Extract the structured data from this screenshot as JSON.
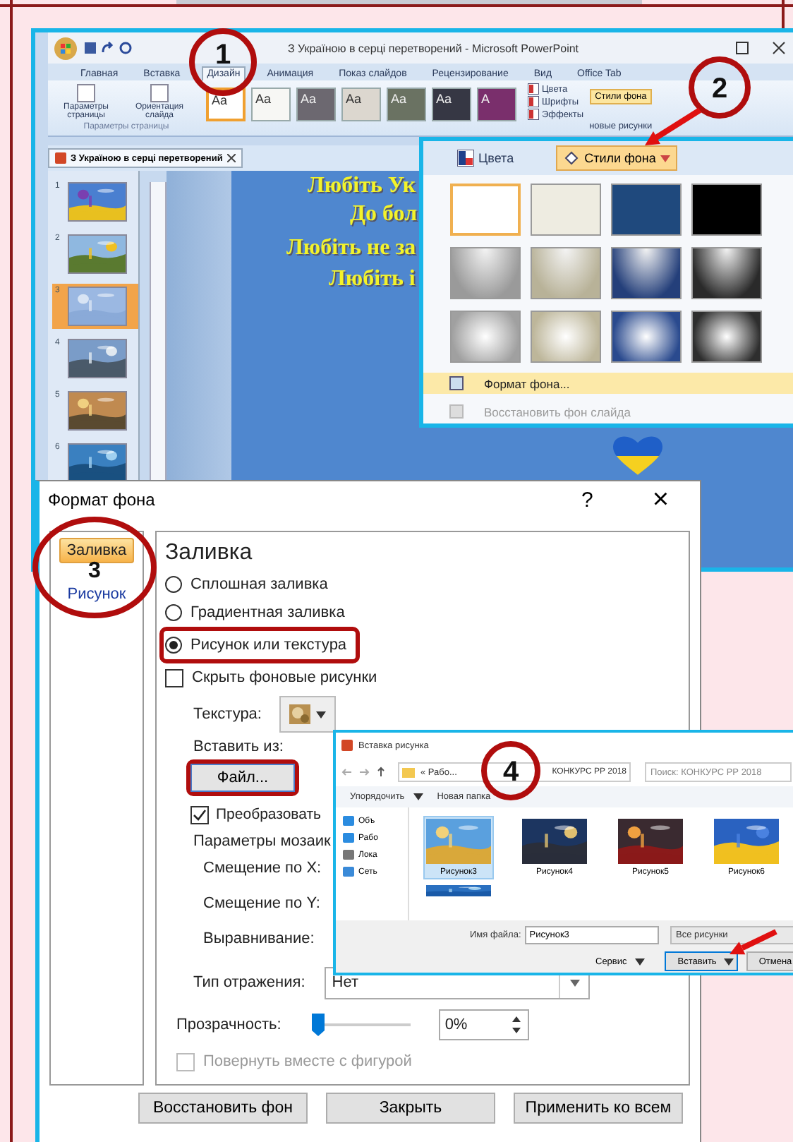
{
  "powerpoint": {
    "title": "З Україною в серці перетворений - Microsoft PowerPoint",
    "tabs": [
      {
        "label": "Главная",
        "selected": false
      },
      {
        "label": "Вставка",
        "selected": false
      },
      {
        "label": "Дизайн",
        "selected": true
      },
      {
        "label": "Анимация",
        "selected": false
      },
      {
        "label": "Показ слайдов",
        "selected": false
      },
      {
        "label": "Рецензирование",
        "selected": false
      },
      {
        "label": "Вид",
        "selected": false
      },
      {
        "label": "Office Tab",
        "selected": false
      }
    ],
    "page_setup_buttons": [
      "Параметры страницы",
      "Ориентация слайда"
    ],
    "page_setup_group": "Параметры страницы",
    "themes": [
      {
        "label": "Aa",
        "color": "#ffffff",
        "selected": true
      },
      {
        "label": "Aa",
        "color": "#f7f7f4",
        "selected": false
      },
      {
        "label": "Aa",
        "color": "#6c6870",
        "selected": false
      },
      {
        "label": "Aa",
        "color": "#dcd7cf",
        "selected": false
      },
      {
        "label": "Aa",
        "color": "#6a7262",
        "selected": false
      },
      {
        "label": "Aa",
        "color": "#363744",
        "selected": false
      },
      {
        "label": "A",
        "color": "#7a2f6c",
        "selected": false
      }
    ],
    "theme_options": [
      "Цвета",
      "Шрифты",
      "Эффекты"
    ],
    "background_styles": "Стили фона",
    "hide_graphics": "новые рисунки",
    "document_tab": "З Україною в серці перетворений",
    "slides": [
      {
        "number": "1",
        "selected": false
      },
      {
        "number": "2",
        "selected": false
      },
      {
        "number": "3",
        "selected": true
      },
      {
        "number": "4",
        "selected": false
      },
      {
        "number": "5",
        "selected": false
      },
      {
        "number": "6",
        "selected": false
      }
    ],
    "slide_text": [
      "Любіть Ук",
      "До бол",
      "Любіть не за",
      "Любіть і"
    ]
  },
  "styles_menu": {
    "colors": "Цвета",
    "button": "Стили фона",
    "swatches": [
      {
        "kind": "solid",
        "color": "#ffffff",
        "selected": true
      },
      {
        "kind": "solid",
        "color": "#eeece1",
        "selected": false
      },
      {
        "kind": "solid",
        "color": "#1f497d",
        "selected": false
      },
      {
        "kind": "solid",
        "color": "#000000",
        "selected": false
      },
      {
        "kind": "gradient",
        "color": "#9a9a9a",
        "selected": false
      },
      {
        "kind": "gradient",
        "color": "#b8b298",
        "selected": false
      },
      {
        "kind": "gradient",
        "color": "#243f7a",
        "selected": false
      },
      {
        "kind": "gradient",
        "color": "#2a2a2a",
        "selected": false
      },
      {
        "kind": "radial",
        "color": "#a0a0a0",
        "selected": false
      },
      {
        "kind": "radial",
        "color": "#bdb69a",
        "selected": false
      },
      {
        "kind": "radial",
        "color": "#2a4a8e",
        "selected": false
      },
      {
        "kind": "radial",
        "color": "#2e2e2e",
        "selected": false
      }
    ],
    "items": [
      {
        "label": "Формат фона...",
        "disabled": false,
        "selected": true
      },
      {
        "label": "Восстановить фон слайда",
        "disabled": true,
        "selected": false
      }
    ]
  },
  "format_dialog": {
    "title": "Формат фона",
    "help": "?",
    "close": "×",
    "sections": [
      {
        "label": "Заливка",
        "selected": true
      },
      {
        "label": "Рисунок",
        "selected": false
      }
    ],
    "heading": "Заливка",
    "fill_options": [
      {
        "label": "Сплошная заливка",
        "selected": false
      },
      {
        "label": "Градиентная заливка",
        "selected": false
      },
      {
        "label": "Рисунок или текстура",
        "selected": true
      }
    ],
    "hide_graphics": {
      "label": "Скрыть фоновые рисунки",
      "checked": false
    },
    "texture_label": "Текстура:",
    "insert_from": "Вставить из:",
    "file_button": "Файл...",
    "tile": {
      "label": "Преобразовать",
      "checked": true
    },
    "tiling_heading": "Параметры мозаик",
    "offset_x": "Смещение по X:",
    "offset_y": "Смещение по Y:",
    "alignment": "Выравнивание:",
    "mirror": {
      "label": "Тип отражения:",
      "value": "Нет"
    },
    "transparency": {
      "label": "Прозрачность:",
      "level": 0,
      "value": "0%"
    },
    "rotate": {
      "label": "Повернуть вместе с фигурой",
      "checked": false,
      "disabled": true
    },
    "buttons": [
      "Восстановить фон",
      "Закрыть",
      "Применить ко всем"
    ]
  },
  "insert_dialog": {
    "title": "Вставка рисунка",
    "path": [
      "« Рабо...",
      "КОНКУРС РР 2018"
    ],
    "search": {
      "placeholder": "Поиск: КОНКУРС РР 2018"
    },
    "toolbar": [
      "Упорядочить",
      "Новая папка"
    ],
    "places": [
      "Объ",
      "Рабо",
      "Лока",
      "Сеть"
    ],
    "files": [
      {
        "name": "Рисунок3",
        "selected": true
      },
      {
        "name": "Рисунок4",
        "selected": false
      },
      {
        "name": "Рисунок5",
        "selected": false
      },
      {
        "name": "Рисунок6",
        "selected": false
      }
    ],
    "filename": {
      "label": "Имя файла:",
      "value": "Рисунок3"
    },
    "filter": "Все рисунки",
    "tools": "Сервис",
    "insert": "Вставить",
    "cancel": "Отмена"
  },
  "annotations": {
    "steps": [
      "1",
      "2",
      "3",
      "4"
    ]
  }
}
